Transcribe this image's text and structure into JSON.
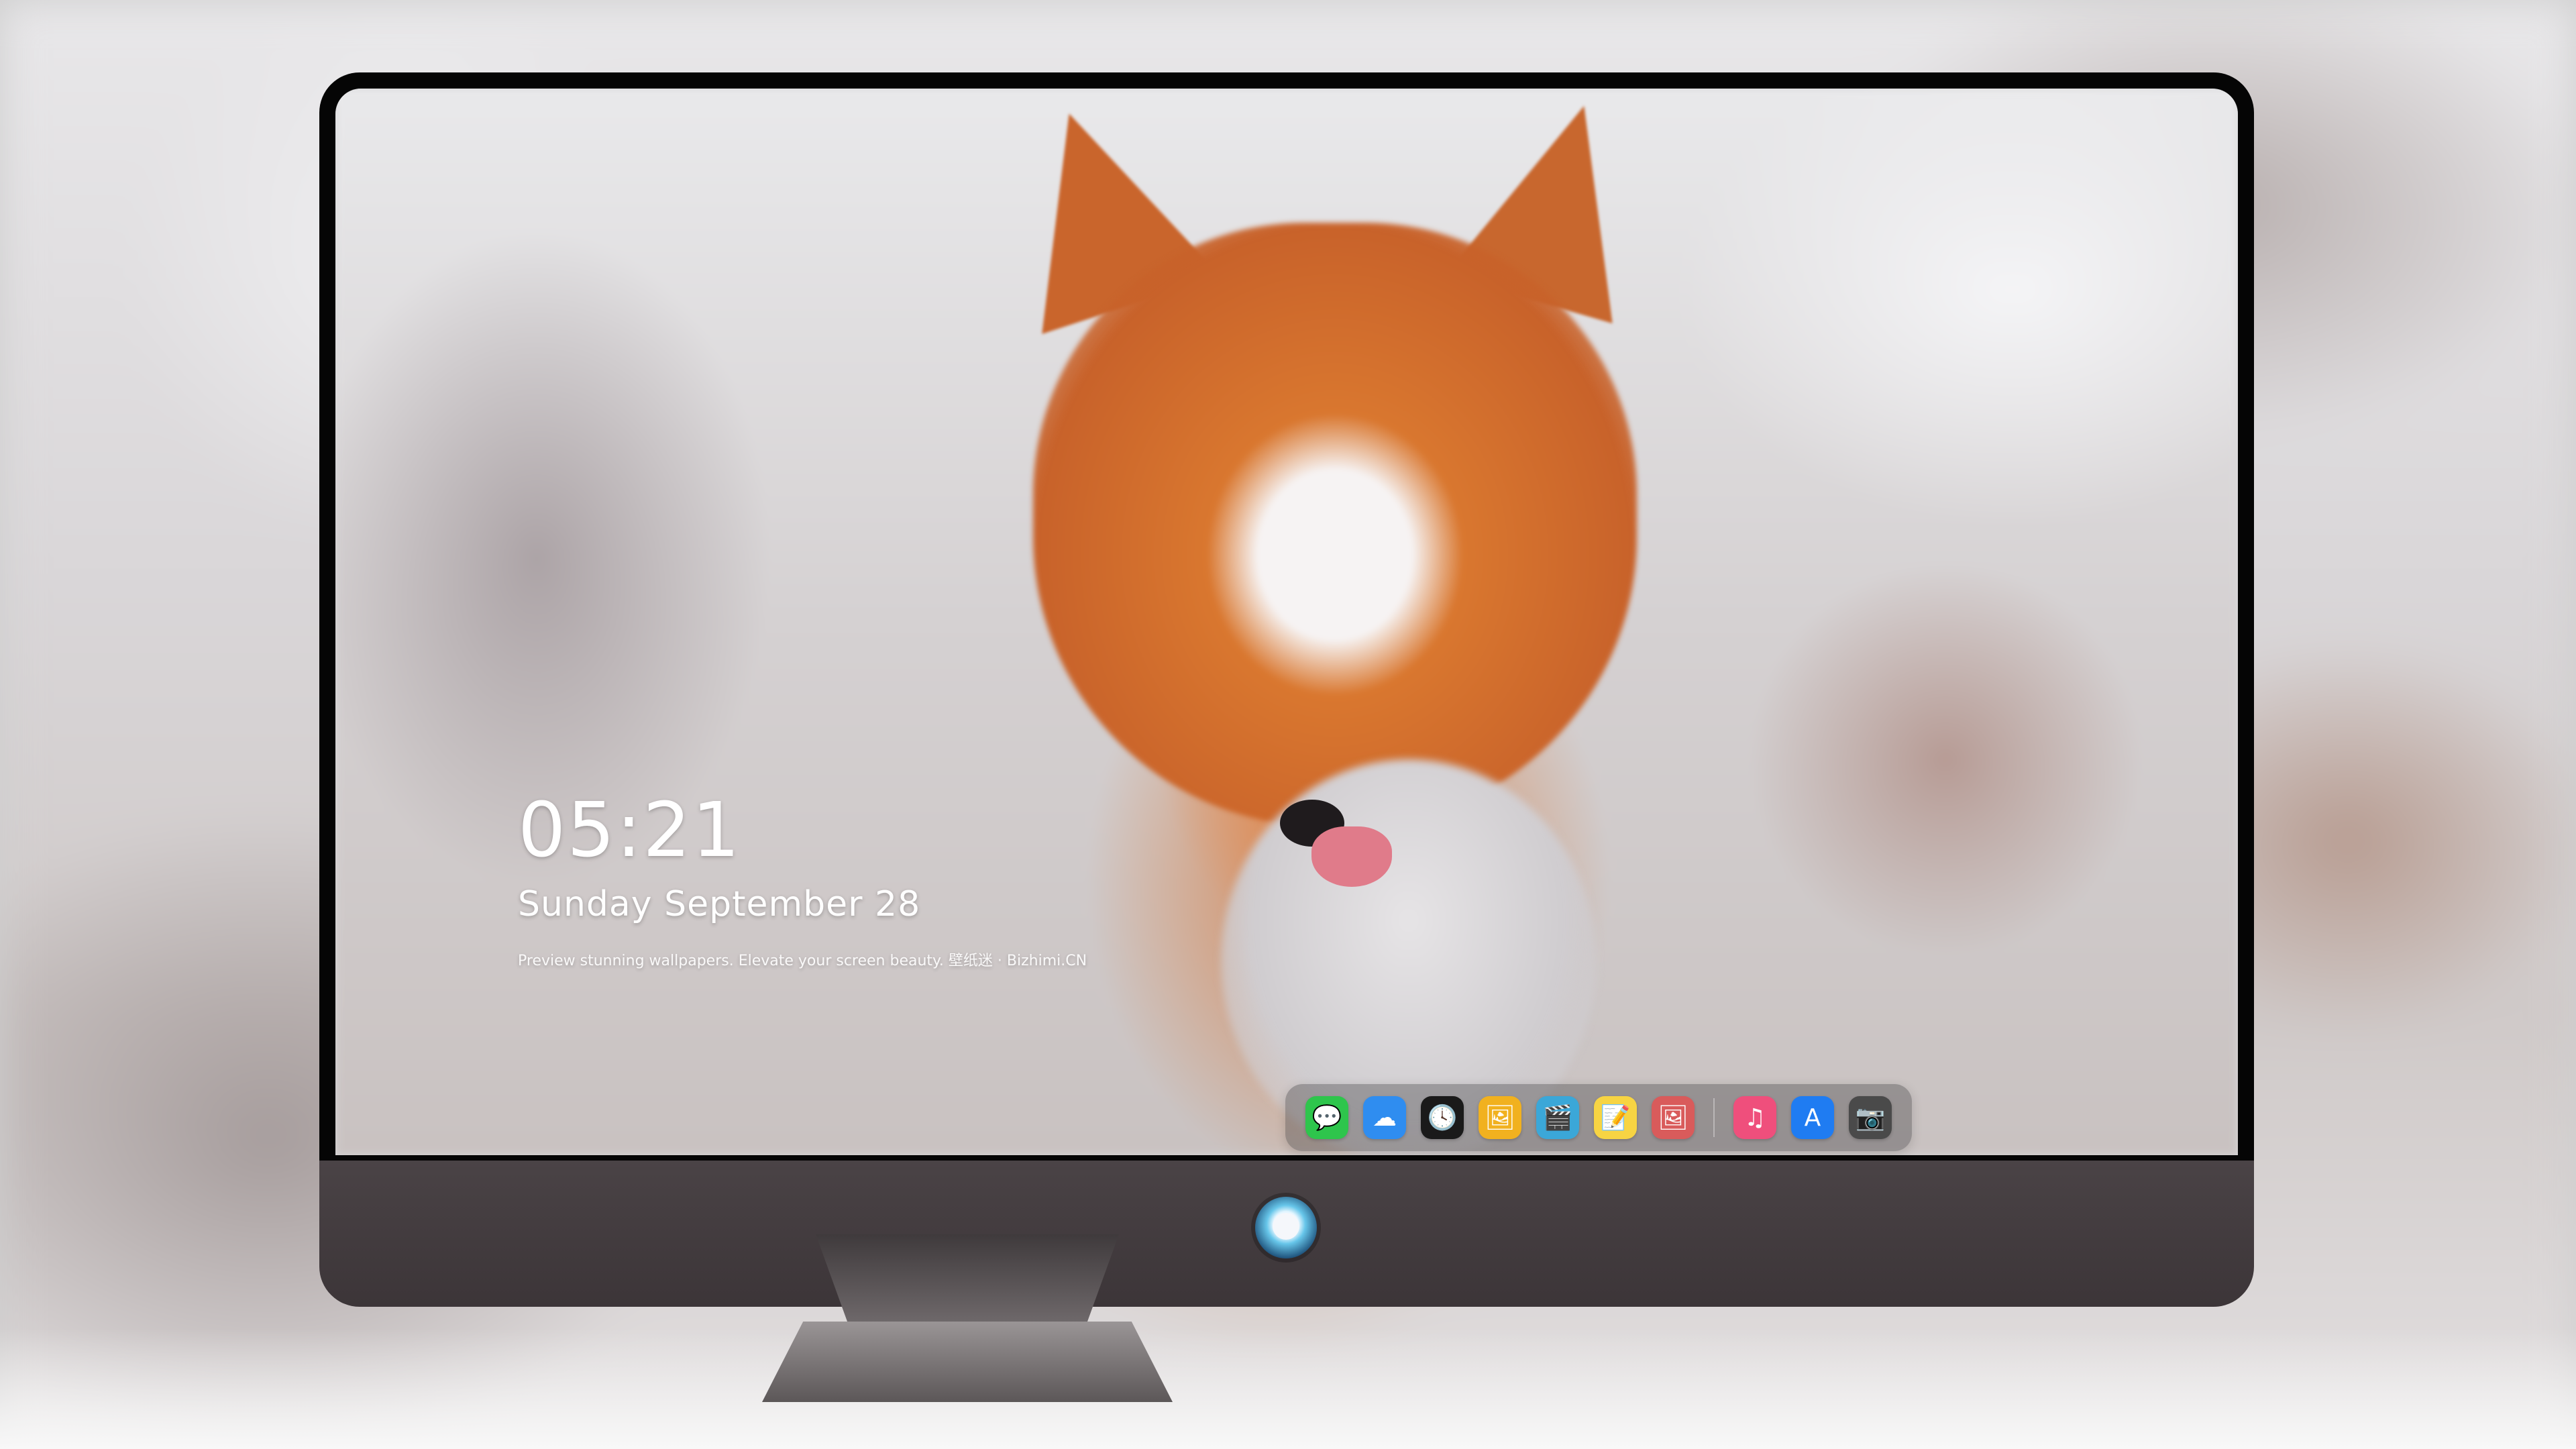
{
  "lock_screen": {
    "time": "05:21",
    "date": "Sunday September  28",
    "tagline": "Preview stunning wallpapers. Elevate your screen beauty. 壁纸迷 · Bizhimi.CN"
  },
  "dock": {
    "items": [
      {
        "name": "messages-icon",
        "glyph": "💬",
        "color": "#2ec54c"
      },
      {
        "name": "weather-icon",
        "glyph": "☁",
        "color": "#2f8df0"
      },
      {
        "name": "clock-icon",
        "glyph": "🕓",
        "color": "#1a1a1a"
      },
      {
        "name": "preview-icon",
        "glyph": "🖼",
        "color": "#f1b11f"
      },
      {
        "name": "clips-icon",
        "glyph": "🎬",
        "color": "#3ba7d8"
      },
      {
        "name": "notes-icon",
        "glyph": "📝",
        "color": "#f7d443"
      },
      {
        "name": "photo-booth-icon",
        "glyph": "🖼",
        "color": "#d95b5b"
      },
      {
        "name": "music-icon",
        "glyph": "♫",
        "color": "#ef4f7c"
      },
      {
        "name": "app-store-icon",
        "glyph": "A",
        "color": "#1f7cf2"
      },
      {
        "name": "camera-icon",
        "glyph": "📷",
        "color": "#4a4a4a"
      }
    ]
  }
}
